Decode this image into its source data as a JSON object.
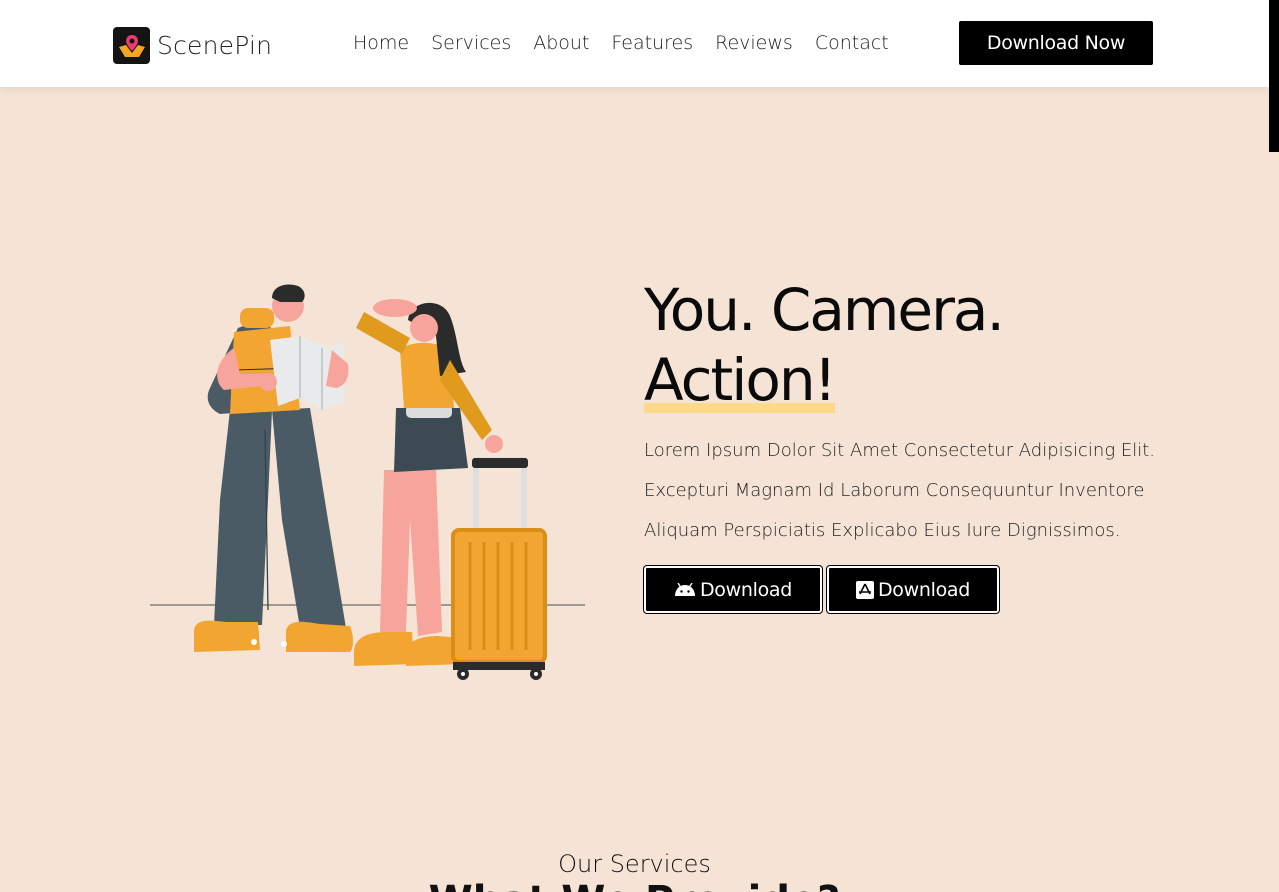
{
  "brand": {
    "name": "ScenePin"
  },
  "nav": {
    "items": [
      "Home",
      "Services",
      "About",
      "Features",
      "Reviews",
      "Contact"
    ],
    "cta_label": "Download Now"
  },
  "hero": {
    "title_line1": "You. Camera.",
    "title_line2": "Action!",
    "description": "Lorem Ipsum Dolor Sit Amet Consectetur Adipisicing Elit. Excepturi Magnam Id Laborum Consequuntur Inventore Aliquam Perspiciatis Explicabo Eius Iure Dignissimos.",
    "android_button": {
      "label": "Download",
      "icon": "android-icon"
    },
    "apple_button": {
      "label": "Download",
      "icon": "app-store-icon"
    }
  },
  "services": {
    "kicker": "Our Services",
    "title": "What We Provide?"
  },
  "colors": {
    "background": "#f5e4d5",
    "accent": "#f5a623",
    "highlight": "#ffd98a",
    "button": "#000000"
  }
}
